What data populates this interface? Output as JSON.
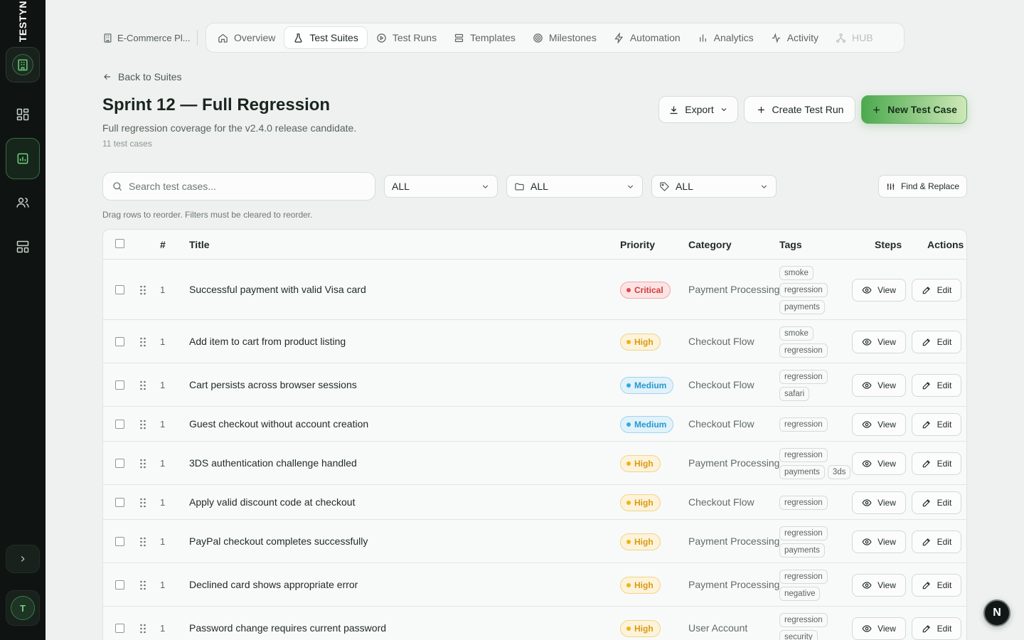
{
  "sidebar": {
    "logo_text": "TESTYN",
    "workspace_icon": "building-icon",
    "items": [
      {
        "icon": "dashboard-grid-icon"
      },
      {
        "icon": "folder-chart-icon",
        "active": true
      },
      {
        "icon": "users-icon"
      },
      {
        "icon": "layout-icon"
      }
    ],
    "avatar_initial": "T"
  },
  "topnav": {
    "project": "E-Commerce Pl...",
    "tabs": [
      {
        "label": "Overview",
        "icon": "home-icon"
      },
      {
        "label": "Test Suites",
        "icon": "flask-icon",
        "active": true
      },
      {
        "label": "Test Runs",
        "icon": "play-circle-icon"
      },
      {
        "label": "Templates",
        "icon": "template-icon"
      },
      {
        "label": "Milestones",
        "icon": "target-icon"
      },
      {
        "label": "Automation",
        "icon": "zap-icon"
      },
      {
        "label": "Analytics",
        "icon": "bar-chart-icon"
      },
      {
        "label": "Activity",
        "icon": "activity-icon"
      },
      {
        "label": "HUB",
        "icon": "network-icon",
        "disabled": true
      }
    ]
  },
  "page": {
    "back_label": "Back to Suites",
    "title": "Sprint 12 — Full Regression",
    "description": "Full regression coverage for the v2.4.0 release candidate.",
    "count": "11 test cases",
    "export_label": "Export",
    "create_run_label": "Create Test Run",
    "new_case_label": "New Test Case"
  },
  "filters": {
    "search_placeholder": "Search test cases...",
    "priority": "ALL",
    "category": "ALL",
    "tag": "ALL",
    "find_replace_label": "Find & Replace",
    "drag_hint": "Drag rows to reorder. Filters must be cleared to reorder."
  },
  "table": {
    "headers": {
      "num": "#",
      "title": "Title",
      "priority": "Priority",
      "category": "Category",
      "tags": "Tags",
      "steps": "Steps",
      "actions": "Actions"
    },
    "view_label": "View",
    "edit_label": "Edit",
    "rows": [
      {
        "num": "1",
        "title": "Successful payment with valid Visa card",
        "priority": "Critical",
        "level": "critical",
        "category": "Payment Processing",
        "tags": [
          "smoke",
          "regression",
          "payments"
        ]
      },
      {
        "num": "1",
        "title": "Add item to cart from product listing",
        "priority": "High",
        "level": "high",
        "category": "Checkout Flow",
        "tags": [
          "smoke",
          "regression"
        ]
      },
      {
        "num": "1",
        "title": "Cart persists across browser sessions",
        "priority": "Medium",
        "level": "medium",
        "category": "Checkout Flow",
        "tags": [
          "regression",
          "safari"
        ]
      },
      {
        "num": "1",
        "title": "Guest checkout without account creation",
        "priority": "Medium",
        "level": "medium",
        "category": "Checkout Flow",
        "tags": [
          "regression"
        ]
      },
      {
        "num": "1",
        "title": "3DS authentication challenge handled",
        "priority": "High",
        "level": "high",
        "category": "Payment Processing",
        "tags": [
          "regression",
          "payments",
          "3ds"
        ]
      },
      {
        "num": "1",
        "title": "Apply valid discount code at checkout",
        "priority": "High",
        "level": "high",
        "category": "Checkout Flow",
        "tags": [
          "regression"
        ]
      },
      {
        "num": "1",
        "title": "PayPal checkout completes successfully",
        "priority": "High",
        "level": "high",
        "category": "Payment Processing",
        "tags": [
          "regression",
          "payments"
        ]
      },
      {
        "num": "1",
        "title": "Declined card shows appropriate error",
        "priority": "High",
        "level": "high",
        "category": "Payment Processing",
        "tags": [
          "regression",
          "negative"
        ]
      },
      {
        "num": "1",
        "title": "Password change requires current password",
        "priority": "High",
        "level": "high",
        "category": "User Account",
        "tags": [
          "regression",
          "security"
        ]
      }
    ]
  },
  "fab_label": "N",
  "colors": {
    "accent": "#4ca94e",
    "sidebar": "#0f1412",
    "critical": "#d23b3b",
    "high": "#d99a12",
    "medium": "#2699cf"
  }
}
